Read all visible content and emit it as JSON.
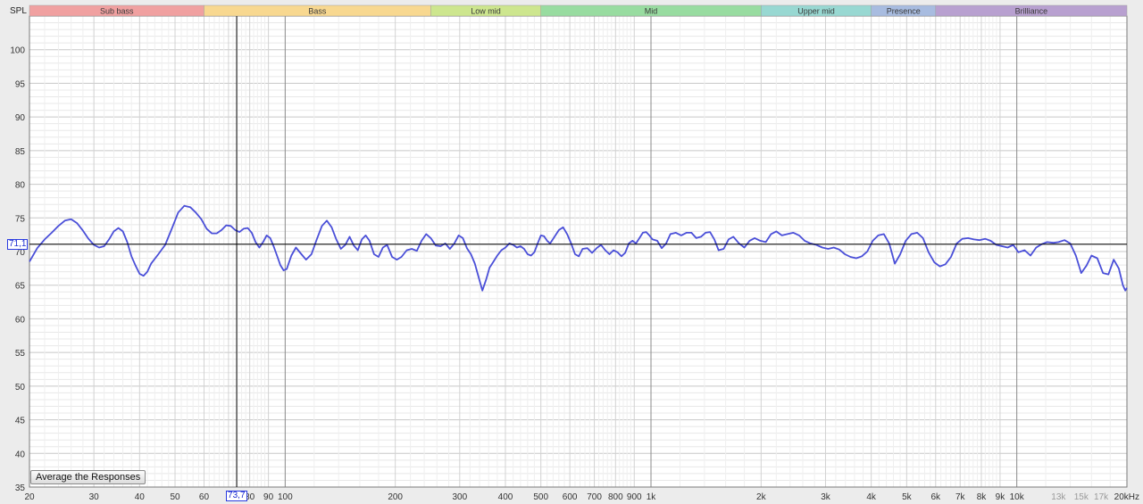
{
  "chart_data": {
    "type": "line",
    "ylabel": "SPL",
    "xunit": "kHz",
    "xscale": "log",
    "xlim": [
      20,
      20000
    ],
    "ylim": [
      35,
      105
    ],
    "grid": true,
    "yticks": [
      35,
      40,
      45,
      50,
      55,
      60,
      65,
      70,
      75,
      80,
      85,
      90,
      95,
      100
    ],
    "xticks": [
      {
        "v": 20,
        "label": "20"
      },
      {
        "v": 30,
        "label": "30"
      },
      {
        "v": 40,
        "label": "40"
      },
      {
        "v": 50,
        "label": "50"
      },
      {
        "v": 60,
        "label": "60"
      },
      {
        "v": 80,
        "label": "80"
      },
      {
        "v": 90,
        "label": "90"
      },
      {
        "v": 100,
        "label": "100"
      },
      {
        "v": 200,
        "label": "200"
      },
      {
        "v": 300,
        "label": "300"
      },
      {
        "v": 400,
        "label": "400"
      },
      {
        "v": 500,
        "label": "500"
      },
      {
        "v": 600,
        "label": "600"
      },
      {
        "v": 700,
        "label": "700"
      },
      {
        "v": 800,
        "label": "800"
      },
      {
        "v": 900,
        "label": "900"
      },
      {
        "v": 1000,
        "label": "1k"
      },
      {
        "v": 2000,
        "label": "2k"
      },
      {
        "v": 3000,
        "label": "3k"
      },
      {
        "v": 4000,
        "label": "4k"
      },
      {
        "v": 5000,
        "label": "5k"
      },
      {
        "v": 6000,
        "label": "6k"
      },
      {
        "v": 7000,
        "label": "7k"
      },
      {
        "v": 8000,
        "label": "8k"
      },
      {
        "v": 9000,
        "label": "9k"
      },
      {
        "v": 10000,
        "label": "10k"
      },
      {
        "v": 13000,
        "label": "13k",
        "dim": true
      },
      {
        "v": 15000,
        "label": "15k",
        "dim": true
      },
      {
        "v": 17000,
        "label": "17k",
        "dim": true
      },
      {
        "v": 20000,
        "label": "20kHz"
      }
    ],
    "bands": [
      {
        "name": "Sub bass",
        "from": 20,
        "to": 60,
        "color": "#f0a0a0"
      },
      {
        "name": "Bass",
        "from": 60,
        "to": 250,
        "color": "#f8d890"
      },
      {
        "name": "Low mid",
        "from": 250,
        "to": 500,
        "color": "#cde68e"
      },
      {
        "name": "Mid",
        "from": 500,
        "to": 2000,
        "color": "#98dca0"
      },
      {
        "name": "Upper mid",
        "from": 2000,
        "to": 4000,
        "color": "#98d8d2"
      },
      {
        "name": "Presence",
        "from": 4000,
        "to": 6000,
        "color": "#a8bce0"
      },
      {
        "name": "Brilliance",
        "from": 6000,
        "to": 20000,
        "color": "#b8a0d0"
      }
    ],
    "cursor": {
      "x": 73.7,
      "y": 71.1,
      "x_label": "73,7",
      "y_label": "71,1"
    },
    "series": [
      {
        "color": "#4a4fd8",
        "points": [
          [
            20,
            68.5
          ],
          [
            21,
            70.5
          ],
          [
            22,
            71.8
          ],
          [
            23,
            72.8
          ],
          [
            24,
            73.8
          ],
          [
            25,
            74.6
          ],
          [
            26,
            74.8
          ],
          [
            27,
            74.2
          ],
          [
            28,
            73.1
          ],
          [
            29,
            71.9
          ],
          [
            30,
            71.0
          ],
          [
            31,
            70.6
          ],
          [
            32,
            70.8
          ],
          [
            33,
            71.8
          ],
          [
            34,
            73.0
          ],
          [
            35,
            73.5
          ],
          [
            36,
            73.0
          ],
          [
            37,
            71.4
          ],
          [
            38,
            69.3
          ],
          [
            39,
            67.9
          ],
          [
            40,
            66.7
          ],
          [
            41,
            66.4
          ],
          [
            42,
            67.0
          ],
          [
            43,
            68.2
          ],
          [
            45,
            69.6
          ],
          [
            47,
            71.0
          ],
          [
            49,
            73.4
          ],
          [
            51,
            75.8
          ],
          [
            53,
            76.8
          ],
          [
            55,
            76.6
          ],
          [
            57,
            75.8
          ],
          [
            59,
            74.8
          ],
          [
            61,
            73.4
          ],
          [
            63,
            72.7
          ],
          [
            65,
            72.7
          ],
          [
            67,
            73.2
          ],
          [
            69,
            73.9
          ],
          [
            71,
            73.8
          ],
          [
            73,
            73.2
          ],
          [
            75,
            72.9
          ],
          [
            77,
            73.4
          ],
          [
            79,
            73.5
          ],
          [
            81,
            72.8
          ],
          [
            83,
            71.4
          ],
          [
            85,
            70.6
          ],
          [
            87,
            71.4
          ],
          [
            89,
            72.4
          ],
          [
            91,
            72.0
          ],
          [
            93,
            70.8
          ],
          [
            95,
            69.4
          ],
          [
            97,
            68.0
          ],
          [
            99,
            67.2
          ],
          [
            101,
            67.4
          ],
          [
            104,
            69.4
          ],
          [
            107,
            70.6
          ],
          [
            110,
            69.8
          ],
          [
            114,
            68.8
          ],
          [
            118,
            69.6
          ],
          [
            122,
            71.8
          ],
          [
            126,
            73.8
          ],
          [
            130,
            74.6
          ],
          [
            134,
            73.6
          ],
          [
            138,
            71.8
          ],
          [
            142,
            70.4
          ],
          [
            146,
            71.0
          ],
          [
            150,
            72.2
          ],
          [
            154,
            70.9
          ],
          [
            158,
            70.2
          ],
          [
            162,
            71.8
          ],
          [
            166,
            72.4
          ],
          [
            170,
            71.6
          ],
          [
            175,
            69.6
          ],
          [
            180,
            69.2
          ],
          [
            185,
            70.6
          ],
          [
            190,
            71.0
          ],
          [
            196,
            69.2
          ],
          [
            202,
            68.8
          ],
          [
            208,
            69.2
          ],
          [
            215,
            70.2
          ],
          [
            222,
            70.4
          ],
          [
            229,
            70.1
          ],
          [
            236,
            71.6
          ],
          [
            243,
            72.6
          ],
          [
            250,
            72.0
          ],
          [
            258,
            70.9
          ],
          [
            266,
            70.8
          ],
          [
            274,
            71.2
          ],
          [
            282,
            70.4
          ],
          [
            290,
            71.2
          ],
          [
            298,
            72.4
          ],
          [
            306,
            72.0
          ],
          [
            314,
            70.5
          ],
          [
            322,
            69.6
          ],
          [
            330,
            68.2
          ],
          [
            338,
            66.2
          ],
          [
            346,
            64.2
          ],
          [
            354,
            65.8
          ],
          [
            362,
            67.6
          ],
          [
            370,
            68.4
          ],
          [
            380,
            69.4
          ],
          [
            390,
            70.2
          ],
          [
            400,
            70.6
          ],
          [
            410,
            71.2
          ],
          [
            420,
            71.0
          ],
          [
            430,
            70.6
          ],
          [
            440,
            70.8
          ],
          [
            450,
            70.4
          ],
          [
            460,
            69.6
          ],
          [
            470,
            69.4
          ],
          [
            480,
            69.9
          ],
          [
            490,
            71.2
          ],
          [
            500,
            72.4
          ],
          [
            510,
            72.3
          ],
          [
            520,
            71.6
          ],
          [
            530,
            71.2
          ],
          [
            545,
            72.2
          ],
          [
            560,
            73.2
          ],
          [
            575,
            73.6
          ],
          [
            590,
            72.6
          ],
          [
            605,
            71.2
          ],
          [
            620,
            69.6
          ],
          [
            635,
            69.3
          ],
          [
            650,
            70.4
          ],
          [
            670,
            70.5
          ],
          [
            690,
            69.8
          ],
          [
            710,
            70.5
          ],
          [
            730,
            71.0
          ],
          [
            750,
            70.2
          ],
          [
            770,
            69.6
          ],
          [
            790,
            70.2
          ],
          [
            810,
            69.9
          ],
          [
            830,
            69.3
          ],
          [
            850,
            69.8
          ],
          [
            870,
            71.2
          ],
          [
            890,
            71.6
          ],
          [
            910,
            71.2
          ],
          [
            930,
            72.0
          ],
          [
            950,
            72.8
          ],
          [
            970,
            72.9
          ],
          [
            990,
            72.4
          ],
          [
            1010,
            71.8
          ],
          [
            1040,
            71.6
          ],
          [
            1070,
            70.5
          ],
          [
            1100,
            71.2
          ],
          [
            1130,
            72.6
          ],
          [
            1170,
            72.8
          ],
          [
            1210,
            72.4
          ],
          [
            1250,
            72.8
          ],
          [
            1290,
            72.8
          ],
          [
            1330,
            72.0
          ],
          [
            1370,
            72.2
          ],
          [
            1410,
            72.8
          ],
          [
            1450,
            72.9
          ],
          [
            1490,
            71.8
          ],
          [
            1530,
            70.2
          ],
          [
            1580,
            70.4
          ],
          [
            1630,
            71.8
          ],
          [
            1680,
            72.2
          ],
          [
            1740,
            71.2
          ],
          [
            1800,
            70.6
          ],
          [
            1860,
            71.6
          ],
          [
            1920,
            72.0
          ],
          [
            1990,
            71.6
          ],
          [
            2060,
            71.4
          ],
          [
            2130,
            72.6
          ],
          [
            2200,
            73.0
          ],
          [
            2280,
            72.4
          ],
          [
            2360,
            72.6
          ],
          [
            2450,
            72.8
          ],
          [
            2540,
            72.4
          ],
          [
            2630,
            71.6
          ],
          [
            2730,
            71.2
          ],
          [
            2830,
            71.0
          ],
          [
            2940,
            70.6
          ],
          [
            3050,
            70.4
          ],
          [
            3160,
            70.6
          ],
          [
            3270,
            70.3
          ],
          [
            3390,
            69.6
          ],
          [
            3510,
            69.2
          ],
          [
            3640,
            69.0
          ],
          [
            3770,
            69.3
          ],
          [
            3900,
            70.0
          ],
          [
            4040,
            71.6
          ],
          [
            4180,
            72.4
          ],
          [
            4330,
            72.6
          ],
          [
            4480,
            71.2
          ],
          [
            4640,
            68.2
          ],
          [
            4800,
            69.6
          ],
          [
            4970,
            71.6
          ],
          [
            5150,
            72.6
          ],
          [
            5340,
            72.8
          ],
          [
            5540,
            72.0
          ],
          [
            5740,
            69.9
          ],
          [
            5950,
            68.4
          ],
          [
            6160,
            67.8
          ],
          [
            6380,
            68.1
          ],
          [
            6610,
            69.2
          ],
          [
            6850,
            71.2
          ],
          [
            7100,
            71.9
          ],
          [
            7360,
            72.0
          ],
          [
            7630,
            71.8
          ],
          [
            7900,
            71.7
          ],
          [
            8190,
            71.9
          ],
          [
            8480,
            71.6
          ],
          [
            8790,
            71.0
          ],
          [
            9110,
            70.8
          ],
          [
            9440,
            70.6
          ],
          [
            9780,
            71.0
          ],
          [
            10100,
            69.9
          ],
          [
            10500,
            70.2
          ],
          [
            10900,
            69.4
          ],
          [
            11300,
            70.6
          ],
          [
            11700,
            71.1
          ],
          [
            12100,
            71.4
          ],
          [
            12600,
            71.3
          ],
          [
            13000,
            71.4
          ],
          [
            13500,
            71.7
          ],
          [
            14000,
            71.2
          ],
          [
            14500,
            69.4
          ],
          [
            15000,
            66.8
          ],
          [
            15500,
            67.9
          ],
          [
            16000,
            69.4
          ],
          [
            16600,
            69.0
          ],
          [
            17200,
            66.8
          ],
          [
            17800,
            66.6
          ],
          [
            18400,
            68.8
          ],
          [
            19000,
            67.5
          ],
          [
            19500,
            65.0
          ],
          [
            19800,
            64.2
          ],
          [
            20000,
            64.6
          ]
        ]
      }
    ]
  },
  "ui": {
    "average_button": "Average the Responses"
  }
}
